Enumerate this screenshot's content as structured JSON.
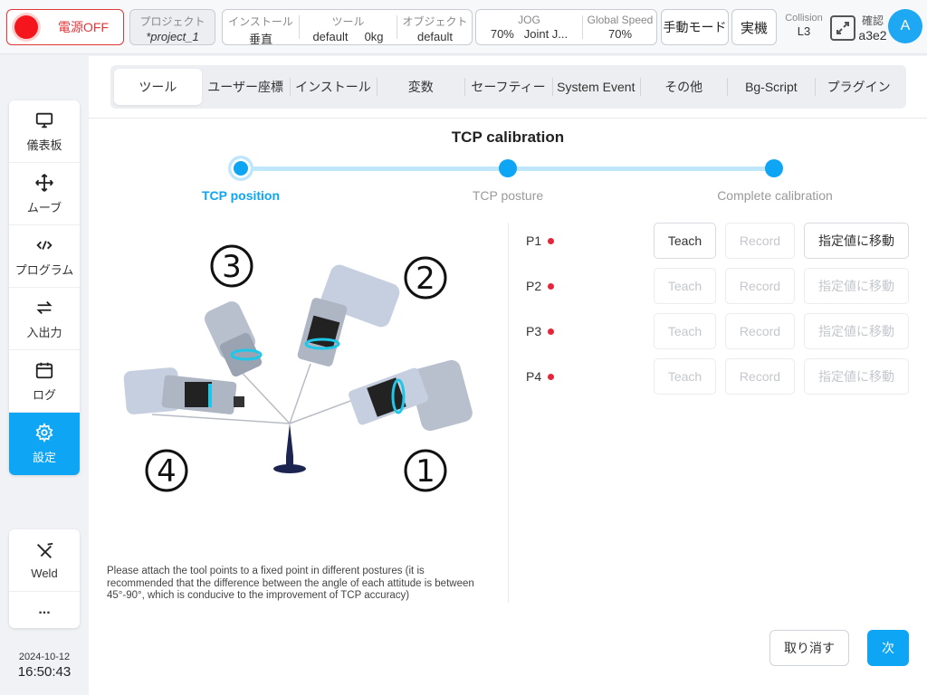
{
  "topbar": {
    "power_label": "電源OFF",
    "project": {
      "label": "プロジェクト",
      "value": "*project_1"
    },
    "install": {
      "label": "インストール",
      "value": "垂直"
    },
    "tool": {
      "label": "ツール",
      "value": "default",
      "weight": "0kg"
    },
    "object": {
      "label": "オブジェクト",
      "value": "default"
    },
    "jog": {
      "label": "JOG",
      "value": "70%",
      "mode": "Joint J..."
    },
    "global_speed": {
      "label": "Global Speed",
      "value": "70%"
    },
    "manual_mode": "手動モード",
    "real_mode": "実機",
    "collision": {
      "label": "Collision",
      "value": "L3"
    },
    "confirm": {
      "label": "確認",
      "value": "a3e2"
    },
    "avatar": "A"
  },
  "sidebar": {
    "items": [
      {
        "label": "儀表板",
        "icon": "monitor-icon"
      },
      {
        "label": "ムーブ",
        "icon": "move-icon"
      },
      {
        "label": "プログラム",
        "icon": "code-icon"
      },
      {
        "label": "入出力",
        "icon": "swap-icon"
      },
      {
        "label": "ログ",
        "icon": "calendar-icon"
      },
      {
        "label": "設定",
        "icon": "gear-icon",
        "active": true
      }
    ],
    "extra": [
      {
        "label": "Weld",
        "icon": "weld-icon"
      },
      {
        "label": "...",
        "icon": "more-icon"
      }
    ],
    "date": "2024-10-12",
    "time": "16:50:43"
  },
  "tabs": [
    "ツール",
    "ユーザー座標",
    "インストール",
    "変数",
    "セーフティー",
    "System Event",
    "その他",
    "Bg-Script",
    "プラグイン"
  ],
  "active_tab": 0,
  "page": {
    "title": "TCP calibration",
    "steps": [
      "TCP position",
      "TCP posture",
      "Complete calibration"
    ],
    "current_step": 0,
    "illustration_labels": [
      "③",
      "②",
      "④",
      "①"
    ],
    "hint": "Please attach the tool points to a fixed point in different postures (it is recommended that the difference between the angle of each attitude is between 45°-90°, which is conducive to the improvement of TCP accuracy)",
    "points": [
      {
        "label": "P1",
        "teach": "Teach",
        "record": "Record",
        "move": "指定値に移動",
        "enabled": true
      },
      {
        "label": "P2",
        "teach": "Teach",
        "record": "Record",
        "move": "指定値に移動",
        "enabled": false
      },
      {
        "label": "P3",
        "teach": "Teach",
        "record": "Record",
        "move": "指定値に移動",
        "enabled": false
      },
      {
        "label": "P4",
        "teach": "Teach",
        "record": "Record",
        "move": "指定値に移動",
        "enabled": false
      }
    ],
    "cancel": "取り消す",
    "next": "次"
  },
  "colors": {
    "accent": "#0ea5f5",
    "power": "#e0373a",
    "point_dot": "#e8243a"
  }
}
